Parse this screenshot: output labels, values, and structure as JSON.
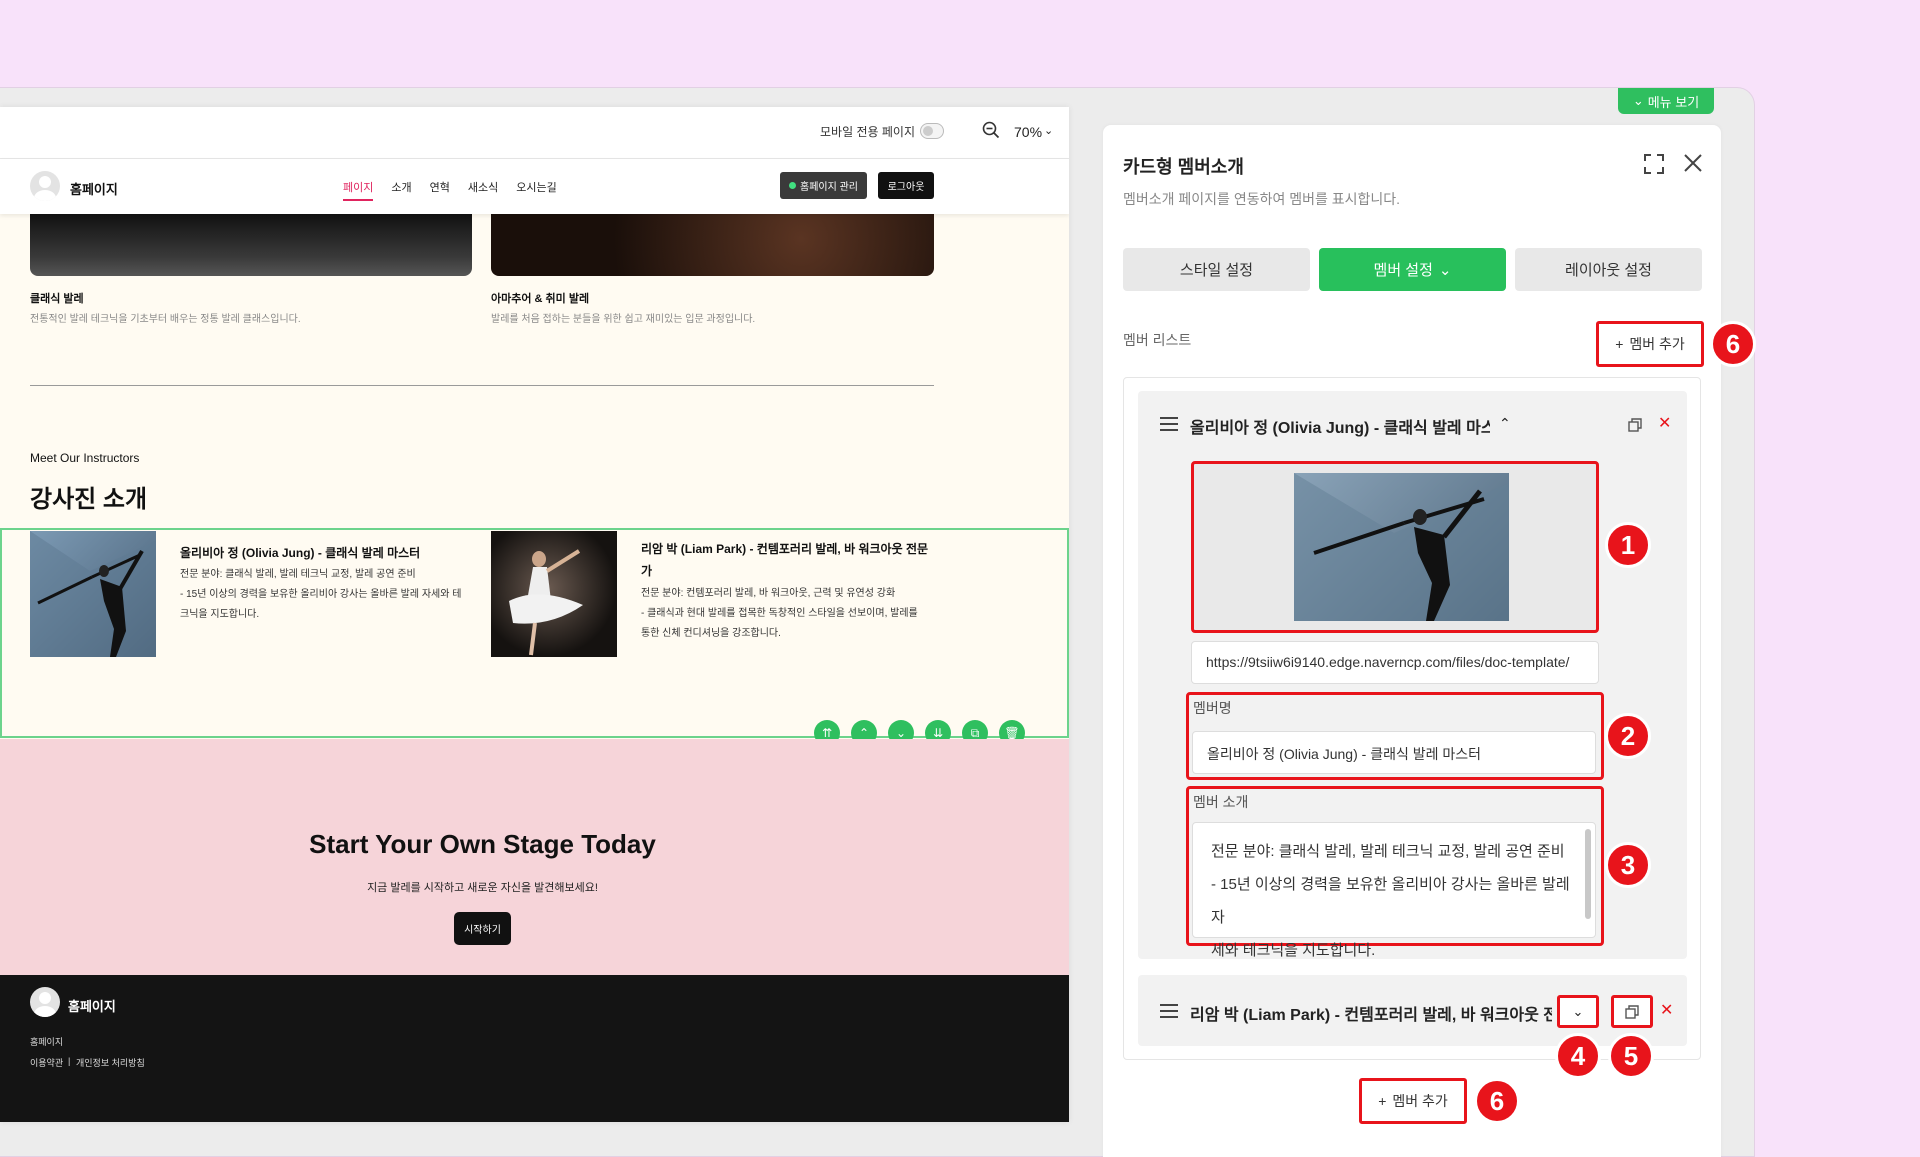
{
  "preview": {
    "topbar": {
      "mobile_label": "모바일 전용 페이지",
      "zoom": "70%"
    },
    "header": {
      "site_name": "홈페이지",
      "nav": [
        "페이지",
        "소개",
        "연혁",
        "새소식",
        "오시는길"
      ],
      "manage_button": "홈페이지 관리",
      "logout_button": "로그아웃"
    },
    "cards": [
      {
        "title": "클래식 발레",
        "desc": "전통적인 발레 테크닉을 기초부터 배우는 정통 발레 클래스입니다."
      },
      {
        "title": "아마추어 & 취미 발레",
        "desc": "발레를 처음 접하는 분들을 위한 쉽고 재미있는 입문 과정입니다."
      }
    ],
    "instructors": {
      "eyebrow": "Meet Our Instructors",
      "title": "강사진 소개",
      "members": [
        {
          "name": "올리비아 정 (Olivia Jung) - 클래식 발레 마스터",
          "desc1": "전문 분야: 클래식 발레, 발레 테크닉 교정, 발레 공연 준비",
          "desc2": "- 15년 이상의 경력을 보유한 올리비아 강사는 올바른 발레 자세와 테",
          "desc3": "크닉을 지도합니다."
        },
        {
          "name1": "리암 박 (Liam Park) - 컨템포러리 발레, 바 워크아웃 전문",
          "name2": "가",
          "desc1": "전문 분야: 컨템포러리 발레, 바 워크아웃, 근력 및 유연성 강화",
          "desc2": "- 클래식과 현대 발레를 접목한 독창적인 스타일을 선보이며, 발레를",
          "desc3": "통한 신체 컨디셔닝을 강조합니다."
        }
      ]
    },
    "cta": {
      "title": "Start Your Own Stage Today",
      "subtitle": "지금 발레를 시작하고 새로운 자신을 발견해보세요!",
      "button": "시작하기"
    },
    "footer": {
      "site_name": "홈페이지",
      "line": "홈페이지",
      "terms": "이용약관",
      "privacy": "개인정보 처리방침"
    }
  },
  "panel": {
    "menu_tab": "메뉴 보기",
    "title": "카드형 멤버소개",
    "subtitle": "멤버소개 페이지를 연동하여 멤버를 표시합니다.",
    "tabs": [
      "스타일 설정",
      "멤버 설정",
      "레이아웃 설정"
    ],
    "list_label": "멤버 리스트",
    "add_member": "멤버 추가",
    "items": [
      {
        "title": "올리비아 정 (Olivia Jung) - 클래식 발레 마스터",
        "image_url": "https://9tsiiw6i9140.edge.naverncp.com/files/doc-template/",
        "name_label": "멤버명",
        "name_value": "올리비아 정 (Olivia Jung) - 클래식 발레 마스터",
        "intro_label": "멤버 소개",
        "intro_line1": "전문 분야: 클래식 발레, 발레 테크닉 교정, 발레 공연 준비",
        "intro_line2": "- 15년 이상의 경력을 보유한 올리비아 강사는 올바른 발레 자",
        "intro_line3": "세와 테크닉을 지도합니다."
      },
      {
        "title": "리암 박 (Liam Park) - 컨템포러리 발레, 바 워크아웃 전문가"
      }
    ],
    "badges": [
      "1",
      "2",
      "3",
      "4",
      "5",
      "6",
      "6"
    ]
  },
  "colors": {
    "accent_green": "#28c05c",
    "highlight_red": "#e8141b",
    "nav_active": "#e0245e"
  }
}
